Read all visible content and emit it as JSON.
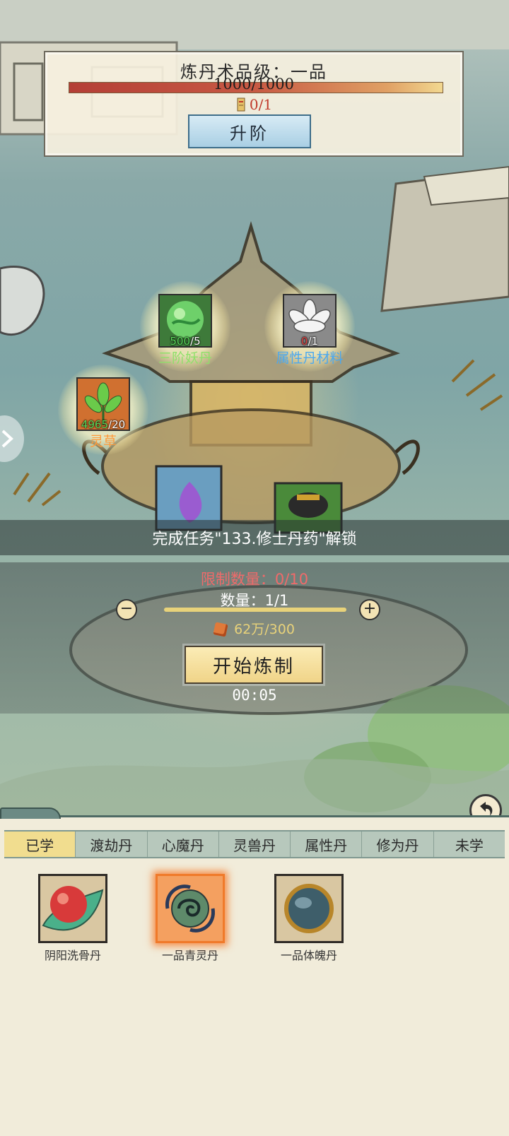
{
  "alchemy": {
    "rank_title": "炼丹术品级：一品",
    "exp_text": "1000/1000",
    "exp_progress": 1.0,
    "requirement_text": "0/1",
    "upgrade_label": "升阶"
  },
  "ingredients": [
    {
      "name": "三阶妖丹",
      "have": "500",
      "need": "/5",
      "name_color": "#8fe06a"
    },
    {
      "name": "属性丹材料",
      "have": "0",
      "need": "/1",
      "name_color": "#4aa8f0"
    },
    {
      "name": "灵草",
      "have": "4965",
      "need": "/20",
      "name_color": "#ff9a3a"
    }
  ],
  "unlock_text": "完成任务\"133.修士丹药\"解锁",
  "craft": {
    "limit_text": "限制数量：0/10",
    "quantity_text": "数量：1/1",
    "minus_label": "−",
    "plus_label": "+",
    "cost_text": "62万/300",
    "start_label": "开始炼制",
    "timer": "00:05"
  },
  "tabs": [
    {
      "label": "已学",
      "active": true
    },
    {
      "label": "渡劫丹",
      "active": false
    },
    {
      "label": "心魔丹",
      "active": false
    },
    {
      "label": "灵兽丹",
      "active": false
    },
    {
      "label": "属性丹",
      "active": false
    },
    {
      "label": "修为丹",
      "active": false
    },
    {
      "label": "未学",
      "active": false
    }
  ],
  "pills": [
    {
      "label": "阴阳洗骨丹",
      "icon": "yinyang-pill-icon",
      "selected": false
    },
    {
      "label": "一品青灵丹",
      "icon": "green-spirit-pill-icon",
      "selected": true
    },
    {
      "label": "一品体魄丹",
      "icon": "body-pill-icon",
      "selected": false
    }
  ]
}
